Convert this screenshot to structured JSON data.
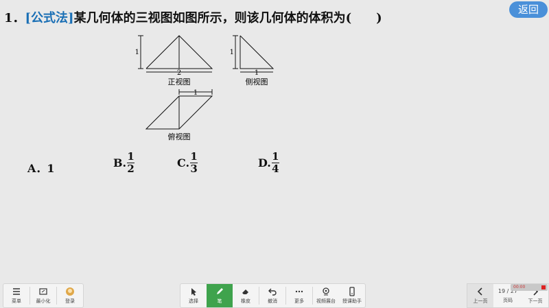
{
  "question": {
    "number": "1．",
    "tag": "[公式法]",
    "text": "某几何体的三视图如图所示，则该几何体的体积为(　　)"
  },
  "back_button": "返回",
  "figure": {
    "front_label": "正视图",
    "side_label": "侧视图",
    "top_label": "俯视图",
    "dim_front_height": "1",
    "dim_front_width": "2",
    "dim_side_height": "1",
    "dim_side_width": "1",
    "dim_top_width": "1"
  },
  "options": {
    "a_label": "A．1",
    "b_label": "B.",
    "b_num": "1",
    "b_den": "2",
    "c_label": "C.",
    "c_num": "1",
    "c_den": "3",
    "d_label": "D.",
    "d_num": "1",
    "d_den": "4"
  },
  "toolbar_left": {
    "menu": "菜单",
    "minimize": "最小化",
    "login": "登录"
  },
  "toolbar_center": {
    "select": "选择",
    "pen": "笔",
    "eraser": "橡皮",
    "undo": "撤消",
    "more": "更多",
    "camera": "视频展台",
    "assistant": "授课助手"
  },
  "pager": {
    "prev": "上一页",
    "page_status": "19 / 27",
    "page": "页码",
    "next": "下一页"
  },
  "recorder": "00:00",
  "colors": {
    "accent": "#4a90d9",
    "pen_active": "#3fa34d",
    "tag": "#1a6fb5"
  }
}
